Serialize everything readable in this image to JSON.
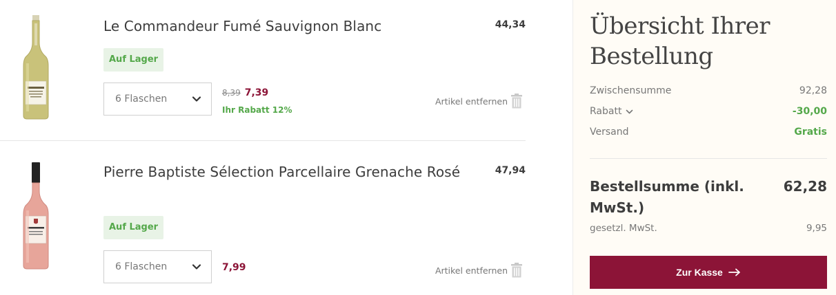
{
  "cart": {
    "items": [
      {
        "name": "Le Commandeur Fumé Sauvignon Blanc",
        "line_total": "44,34",
        "stock": "Auf Lager",
        "quantity": "6 Flaschen",
        "old_price": "8,39",
        "price": "7,39",
        "discount": "Ihr Rabatt 12%",
        "remove_label": "Artikel entfernen",
        "bottle_color": "#c9c27a"
      },
      {
        "name": "Pierre Baptiste Sélection Parcellaire Grenache Rosé",
        "line_total": "47,94",
        "stock": "Auf Lager",
        "quantity": "6 Flaschen",
        "price": "7,99",
        "remove_label": "Artikel entfernen",
        "bottle_color": "#e7a59a"
      }
    ]
  },
  "summary": {
    "title": "Übersicht Ihrer Bestellung",
    "subtotal_label": "Zwischensumme",
    "subtotal_value": "92,28",
    "discount_label": "Rabatt",
    "discount_value": "-30,00",
    "shipping_label": "Versand",
    "shipping_value": "Gratis",
    "total_label": "Bestellsumme (inkl. MwSt.)",
    "total_value": "62,28",
    "vat_label": "gesetzl. MwSt.",
    "vat_value": "9,95",
    "checkout_label": "Zur Kasse"
  },
  "colors": {
    "accent": "#8c1437",
    "in_stock_green": "#54a84a",
    "badge_bg": "#e8f3e6",
    "summary_bg": "#fffcf6"
  }
}
